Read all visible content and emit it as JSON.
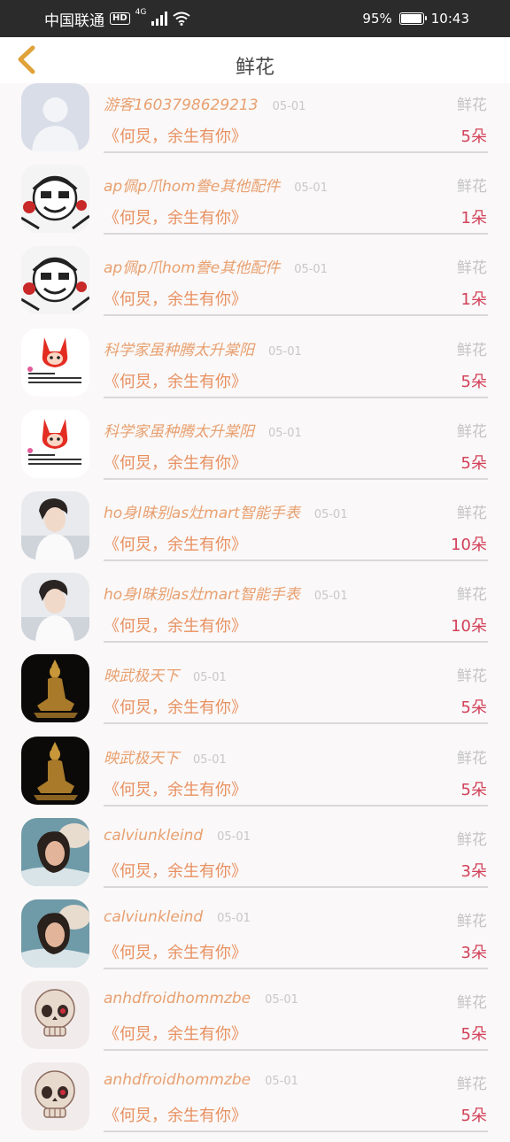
{
  "status_bar": {
    "carrier": "中国联通",
    "hd": "HD",
    "network": "4G",
    "battery": "95%",
    "battery_level": 0.95,
    "time": "10:43"
  },
  "nav": {
    "title": "鲜花"
  },
  "items": [
    {
      "name": "游客1603798629213",
      "date": "05-01",
      "category": "鲜花",
      "message": "《何炅，余生有你》",
      "count": "5朵",
      "avatar": "default-avatar"
    },
    {
      "name": "ap佩p爪hom誊e其他配件",
      "date": "05-01",
      "category": "鲜花",
      "message": "《何炅，余生有你》",
      "count": "1朵",
      "avatar": "manga-avatar"
    },
    {
      "name": "ap佩p爪hom誊e其他配件",
      "date": "05-01",
      "category": "鲜花",
      "message": "《何炅，余生有你》",
      "count": "1朵",
      "avatar": "manga-avatar"
    },
    {
      "name": "科学家虽种腾太升棠阳",
      "date": "05-01",
      "category": "鲜花",
      "message": "《何炅，余生有你》",
      "count": "5朵",
      "avatar": "fox-avatar"
    },
    {
      "name": "科学家虽种腾太升棠阳",
      "date": "05-01",
      "category": "鲜花",
      "message": "《何炅，余生有你》",
      "count": "5朵",
      "avatar": "fox-avatar"
    },
    {
      "name": "ho身l昧别as灶mart智能手表",
      "date": "05-01",
      "category": "鲜花",
      "message": "《何炅，余生有你》",
      "count": "10朵",
      "avatar": "portrait-avatar"
    },
    {
      "name": "ho身l昧别as灶mart智能手表",
      "date": "05-01",
      "category": "鲜花",
      "message": "《何炅，余生有你》",
      "count": "10朵",
      "avatar": "portrait-avatar"
    },
    {
      "name": "映武极天下",
      "date": "05-01",
      "category": "鲜花",
      "message": "《何炅，余生有你》",
      "count": "5朵",
      "avatar": "statue-avatar"
    },
    {
      "name": "映武极天下",
      "date": "05-01",
      "category": "鲜花",
      "message": "《何炅，余生有你》",
      "count": "5朵",
      "avatar": "statue-avatar"
    },
    {
      "name": "calviunkleind",
      "date": "05-01",
      "category": "鲜花",
      "message": "《何炅，余生有你》",
      "count": "3朵",
      "avatar": "woman-avatar"
    },
    {
      "name": "calviunkleind",
      "date": "05-01",
      "category": "鲜花",
      "message": "《何炅，余生有你》",
      "count": "3朵",
      "avatar": "woman-avatar"
    },
    {
      "name": "anhdfroidhommzbe",
      "date": "05-01",
      "category": "鲜花",
      "message": "《何炅，余生有你》",
      "count": "5朵",
      "avatar": "skull-avatar"
    },
    {
      "name": "anhdfroidhommzbe",
      "date": "05-01",
      "category": "鲜花",
      "message": "《何炅，余生有你》",
      "count": "5朵",
      "avatar": "skull-avatar"
    }
  ]
}
